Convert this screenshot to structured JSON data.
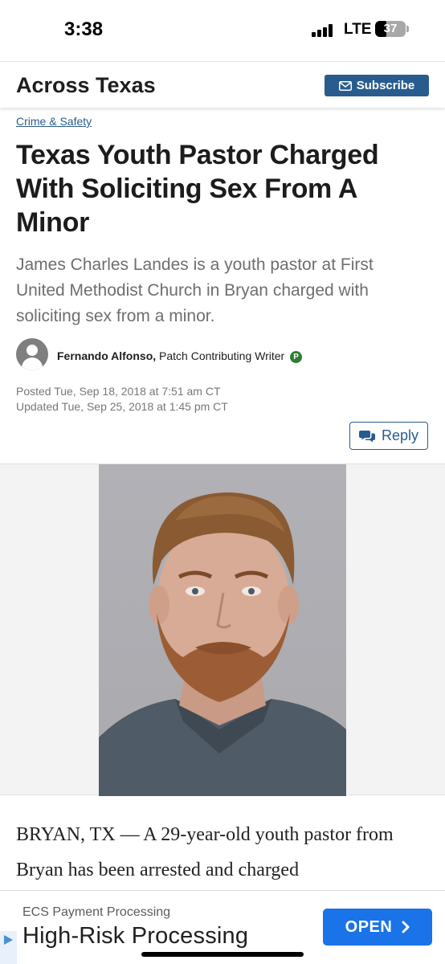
{
  "status_bar": {
    "time": "3:38",
    "network": "LTE",
    "battery": "37",
    "battery_level_percent": 37,
    "signal_bars": 4
  },
  "header": {
    "site_title": "Across Texas",
    "subscribe_label": "Subscribe",
    "subscribe_icon": "envelope-icon",
    "accent_color": "#295c8e"
  },
  "article": {
    "category": "Crime & Safety",
    "headline": "Texas Youth Pastor Charged With Soliciting Sex From A Minor",
    "dek": "James Charles Landes is a youth pastor at First United Methodist Church in Bryan charged with soliciting sex from a minor.",
    "author_name": "Fernando Alfonso,",
    "author_role": " Patch Contributing Writer",
    "author_badge": "P",
    "posted": "Posted Tue, Sep 18, 2018 at 7:51 am CT",
    "updated": "Updated Tue, Sep 25, 2018 at 1:45 pm CT",
    "reply_label": "Reply",
    "reply_icon": "comments-icon",
    "body_text": "BRYAN, TX — A 29-year-old youth pastor from Bryan has been arrested and charged"
  },
  "ad": {
    "sponsor": "ECS Payment Processing",
    "headline": "High-Risk Processing",
    "cta_label": "OPEN",
    "cta_icon": "chevron-right-icon",
    "cta_color": "#1a73e8"
  }
}
